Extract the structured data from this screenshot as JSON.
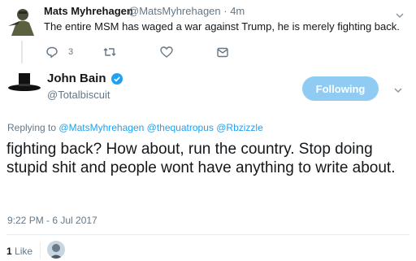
{
  "parent": {
    "name": "Mats Myhrehagen",
    "handle_time": "@MatsMyhrehagen · 4m",
    "text": "The entire MSM has waged a war against Trump, he is merely fighting back.",
    "reply_count": "3"
  },
  "tweet": {
    "name": "John Bain",
    "handle": "@Totalbiscuit",
    "follow_label": "Following",
    "replying_prefix": "Replying to",
    "mentions": [
      "@MatsMyhrehagen",
      "@thequatropus",
      "@Rbzizzle"
    ],
    "body": "fighting back? How about, run the country. Stop doing stupid shit and people wont have anything to write about.",
    "timestamp": "9:22 PM - 6 Jul 2017",
    "like_count": "1",
    "like_label": "Like"
  },
  "colors": {
    "accent": "#1da1f2",
    "follow_button": "#8fcbf3",
    "muted": "#657786"
  }
}
